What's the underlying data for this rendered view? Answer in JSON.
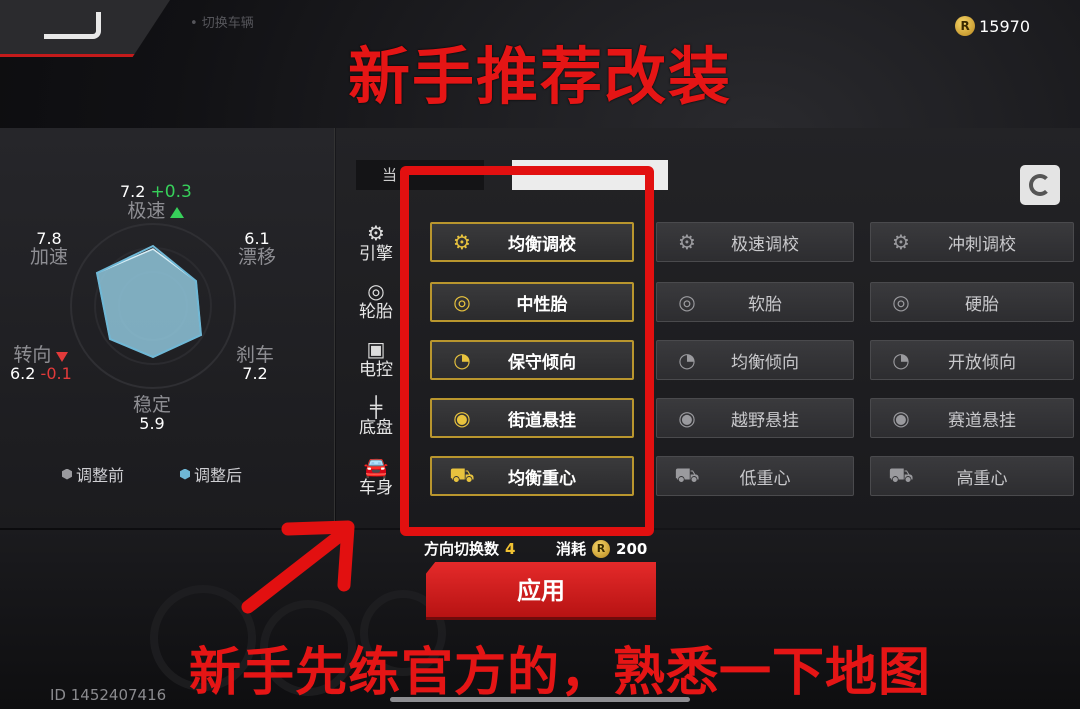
{
  "header": {
    "coins": "15970",
    "faint_tab_text": "• 切换车辆",
    "overlay_title": "新手推荐改装"
  },
  "stats": {
    "top": {
      "value": "7.2",
      "delta": "+0.3",
      "label": "极速"
    },
    "top_left": {
      "value": "7.8",
      "label": "加速"
    },
    "top_right": {
      "value": "6.1",
      "label": "漂移"
    },
    "left": {
      "value": "6.2",
      "delta": "-0.1",
      "label": "转向"
    },
    "right": {
      "value": "7.2",
      "label": "刹车"
    },
    "bottom": {
      "value": "5.9",
      "label": "稳定"
    },
    "legend_before": "调整前",
    "legend_after": "调整后",
    "colors": {
      "before": "#9a9a9e",
      "after": "#6fb8d6",
      "up": "#37d05a",
      "down": "#e23a3a"
    }
  },
  "tabs": {
    "current": "当"
  },
  "categories": [
    {
      "label": "引擎",
      "icon": "engine-icon"
    },
    {
      "label": "轮胎",
      "icon": "tire-icon"
    },
    {
      "label": "电控",
      "icon": "chip-icon"
    },
    {
      "label": "底盘",
      "icon": "chassis-icon"
    },
    {
      "label": "车身",
      "icon": "car-body-icon"
    }
  ],
  "options": [
    [
      "均衡调校",
      "极速调校",
      "冲刺调校"
    ],
    [
      "中性胎",
      "软胎",
      "硬胎"
    ],
    [
      "保守倾向",
      "均衡倾向",
      "开放倾向"
    ],
    [
      "街道悬挂",
      "越野悬挂",
      "赛道悬挂"
    ],
    [
      "均衡重心",
      "低重心",
      "高重心"
    ]
  ],
  "footer": {
    "direction_switches_label": "方向切换数",
    "direction_switches_value": "4",
    "cost_label": "消耗",
    "cost_value": "200",
    "apply_label": "应用",
    "user_id": "ID 1452407416",
    "overlay_caption": "新手先练官方的，熟悉一下地图"
  },
  "accent": {
    "highlight_border": "#b9962e",
    "annotation_red": "#e21010"
  }
}
